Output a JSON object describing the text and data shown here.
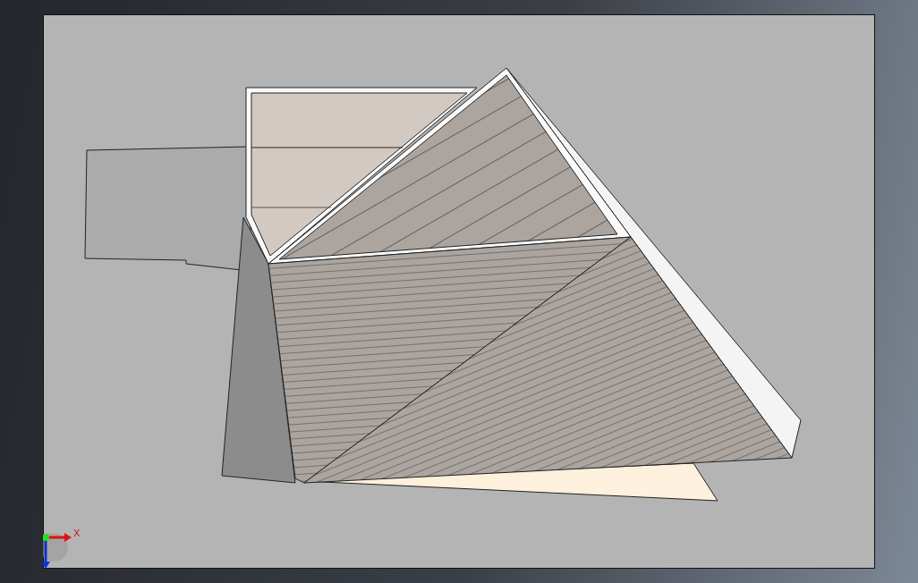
{
  "viewport": {
    "triad": {
      "x_label": "X"
    }
  }
}
